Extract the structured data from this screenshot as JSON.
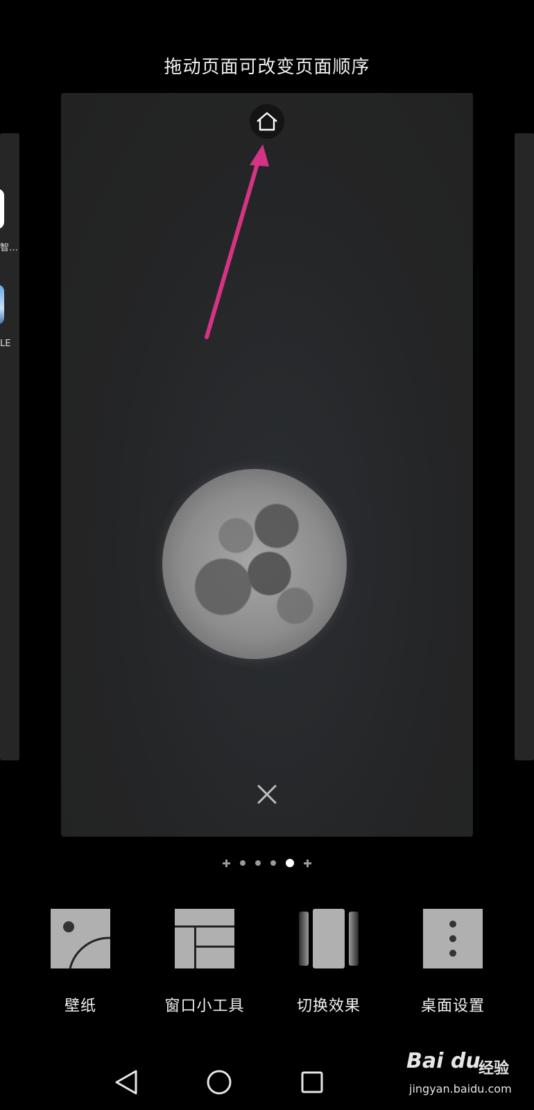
{
  "hint_text": "拖动页面可改变页面顺序",
  "side_left": {
    "app1_label": "智…",
    "app2_label": "LE"
  },
  "page_indicator": {
    "items": [
      "add",
      "page",
      "page",
      "page",
      "page-active",
      "add"
    ]
  },
  "toolbar": {
    "items": [
      {
        "label": "壁纸",
        "icon": "wallpaper-icon"
      },
      {
        "label": "窗口小工具",
        "icon": "widgets-icon"
      },
      {
        "label": "切换效果",
        "icon": "transition-effects-icon"
      },
      {
        "label": "桌面设置",
        "icon": "desktop-settings-icon"
      }
    ]
  },
  "watermark": {
    "brand": "Bai du",
    "brand_cn": "经验",
    "url": "jingyan.baidu.com"
  },
  "colors": {
    "background": "#000000",
    "card": "#242424",
    "arrow": "#d63384",
    "tool_icon": "#b0b0b0"
  }
}
